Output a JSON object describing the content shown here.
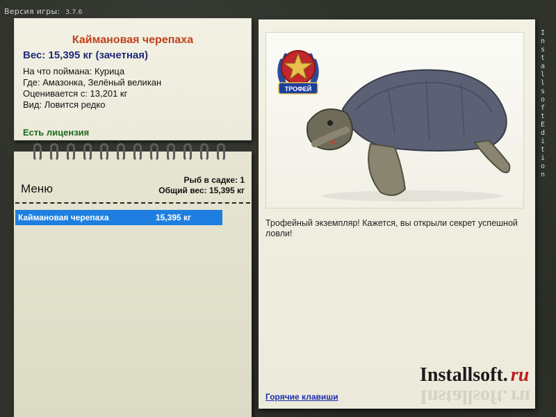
{
  "version": {
    "label": "Версия игры:",
    "number": "3.7.6"
  },
  "fish": {
    "title": "Каймановая черепаха",
    "weight_line": "Вес: 15,395 кг (зачетная)",
    "caught_on": "На что поймана: Курица",
    "location": "Где: Амазонка, Зелёный великан",
    "valued_from": "Оценивается с: 13,201 кг",
    "rarity": "Вид: Ловится редко",
    "license": "Есть лицензия"
  },
  "menu": {
    "title": "Меню",
    "fish_count": "Рыб в садке: 1",
    "total_weight": "Общий вес: 15,395 кг",
    "rows": [
      {
        "name": "Каймановая черепаха",
        "weight": "15,395 кг"
      }
    ]
  },
  "main": {
    "trophy_badge": "ТРОФЕЙ",
    "description": "Трофейный экземпляр! Кажется, вы открыли секрет успешной ловли!",
    "hotkeys_link": "Горячие клавиши",
    "watermark_main": "Installsoft.",
    "watermark_ru": "ru"
  },
  "side_watermark": "InstallsoftEdition",
  "colors": {
    "title": "#c0411a",
    "weight": "#1e2a7a",
    "license": "#1e6a1e",
    "selection": "#1f7fe0",
    "link": "#1b2cb0"
  }
}
